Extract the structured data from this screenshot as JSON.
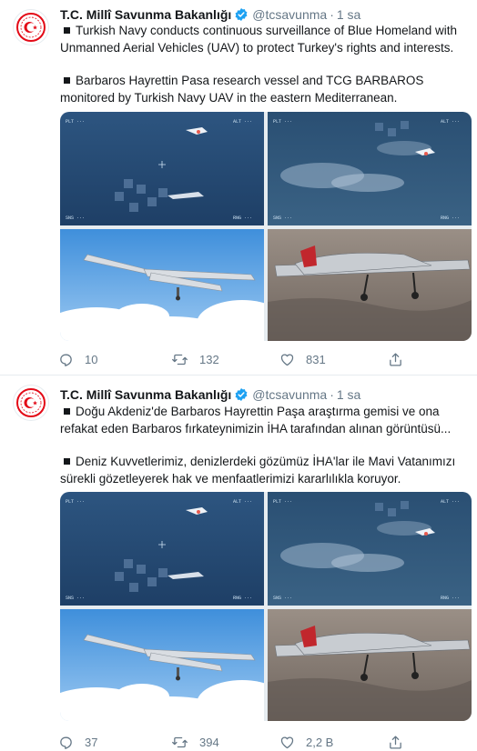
{
  "tweets": [
    {
      "author": "T.C. Millî Savunma Bakanlığı",
      "handle": "@tcsavunma",
      "separator": "·",
      "time": "1 sa",
      "paragraphs": [
        "Turkish Navy conducts continuous surveillance of Blue Homeland with Unmanned Aerial Vehicles (UAV) to protect Turkey's rights and interests.",
        "Barbaros Hayrettin Pasa research vessel and TCG BARBAROS monitored by Turkish Navy UAV in the eastern Mediterranean."
      ],
      "replies": "10",
      "retweets": "132",
      "likes": "831"
    },
    {
      "author": "T.C. Millî Savunma Bakanlığı",
      "handle": "@tcsavunma",
      "separator": "·",
      "time": "1 sa",
      "paragraphs": [
        "Doğu Akdeniz'de Barbaros Hayrettin Paşa araştırma gemisi ve ona refakat eden Barbaros fırkateynimizin İHA tarafından alınan görüntüsü...",
        "Deniz Kuvvetlerimiz, denizlerdeki gözümüz İHA'lar ile Mavi Vatanımızı sürekli gözetleyerek hak ve menfaatlerimizi kararlılıkla koruyor."
      ],
      "replies": "37",
      "retweets": "394",
      "likes": "2,2 B"
    }
  ],
  "icons": {
    "avatar": "ministry-emblem-icon",
    "verified": "verified-badge-icon",
    "reply": "reply-icon",
    "retweet": "retweet-icon",
    "like": "heart-icon",
    "share": "share-icon"
  },
  "colors": {
    "verified": "#1da1f2",
    "emblem_red": "#e30a17",
    "secondary_text": "#657786",
    "sea": "#2f5a86"
  }
}
